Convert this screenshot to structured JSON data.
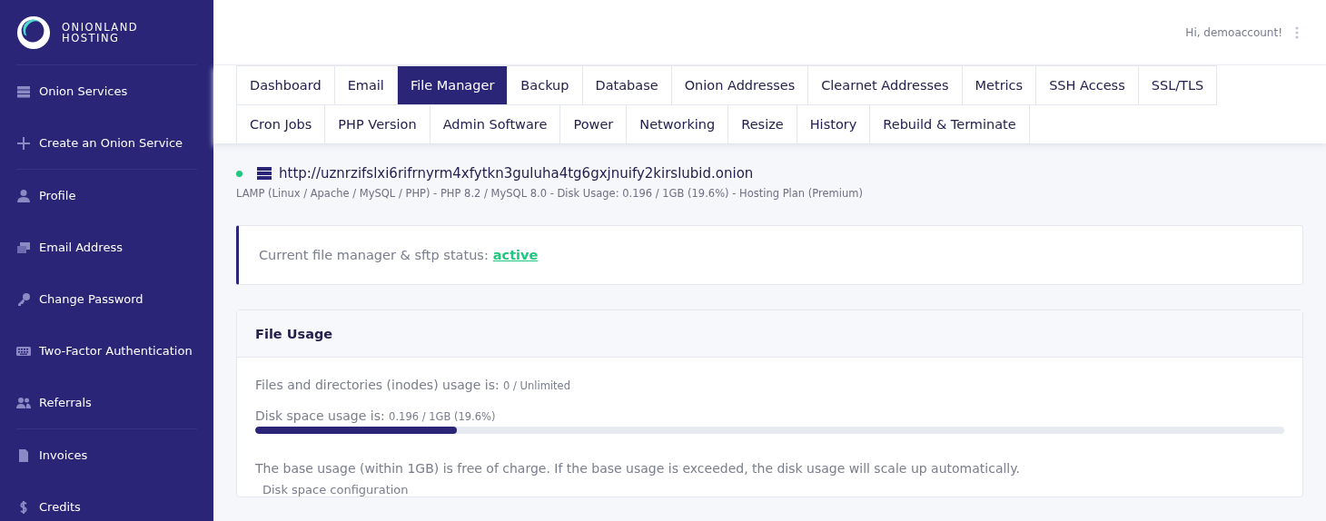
{
  "brand": {
    "line_1": "ONIONLAND",
    "line_2": "HOSTING"
  },
  "sidebar": {
    "groups": [
      [
        {
          "label": "Onion Services"
        },
        {
          "label": "Create an Onion Service"
        }
      ],
      [
        {
          "label": "Profile"
        },
        {
          "label": "Email Address"
        },
        {
          "label": "Change Password"
        },
        {
          "label": "Two-Factor Authentication"
        },
        {
          "label": "Referrals"
        }
      ],
      [
        {
          "label": "Invoices"
        },
        {
          "label": "Credits"
        }
      ]
    ]
  },
  "header": {
    "greeting": "Hi, demoaccount!"
  },
  "tabs": [
    {
      "label": "Dashboard",
      "selected": false
    },
    {
      "label": "Email",
      "selected": false
    },
    {
      "label": "File Manager",
      "selected": true
    },
    {
      "label": "Backup",
      "selected": false
    },
    {
      "label": "Database",
      "selected": false
    },
    {
      "label": "Onion Addresses",
      "selected": false
    },
    {
      "label": "Clearnet Addresses",
      "selected": false
    },
    {
      "label": "Metrics",
      "selected": false
    },
    {
      "label": "SSH Access",
      "selected": false
    },
    {
      "label": "SSL/TLS",
      "selected": false
    },
    {
      "label": "Cron Jobs",
      "selected": false
    },
    {
      "label": "PHP Version",
      "selected": false
    },
    {
      "label": "Admin Software",
      "selected": false
    },
    {
      "label": "Power",
      "selected": false
    },
    {
      "label": "Networking",
      "selected": false
    },
    {
      "label": "Resize",
      "selected": false
    },
    {
      "label": "History",
      "selected": false
    },
    {
      "label": "Rebuild & Terminate",
      "selected": false
    }
  ],
  "service": {
    "online": true,
    "url": "http://uznrzifslxi6rifrnyrm4xfytkn3guluha4tg6gxjnuify2kirslubid.onion",
    "details": "LAMP (Linux / Apache / MySQL / PHP) - PHP 8.2 / MySQL 8.0 - Disk Usage: 0.196 / 1GB (19.6%) - Hosting Plan (Premium)"
  },
  "status_alert": {
    "label": "Current file manager & sftp status:",
    "status": "active"
  },
  "file_usage": {
    "title": "File Usage",
    "inodes_label": "Files and directories (inodes) usage is:",
    "inodes_value": "0 / Unlimited",
    "disk_label": "Disk space usage is:",
    "disk_value": "0.196 / 1GB (19.6%)",
    "level": 0.196,
    "note": "The base usage (within 1GB) is free of charge. If the base usage is exceeded, the disk usage will scale up automatically.",
    "config_label": "Disk space configuration"
  }
}
